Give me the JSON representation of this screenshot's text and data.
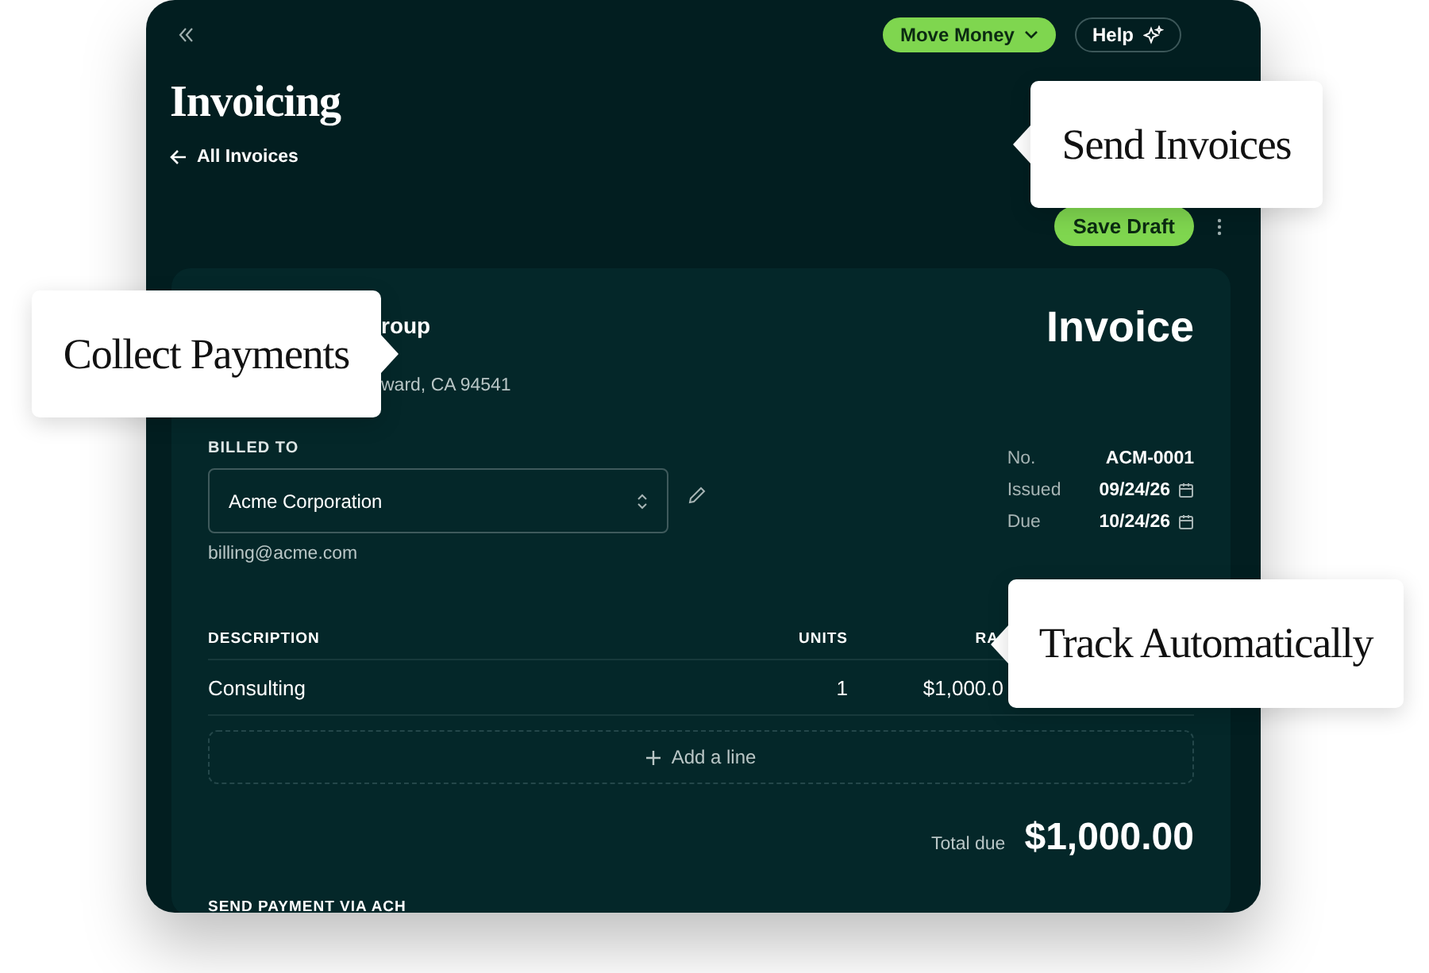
{
  "top_bar": {
    "buttons": [
      {
        "label": "Move Money",
        "kind": "primary"
      },
      {
        "label": "Help",
        "kind": "outline"
      }
    ]
  },
  "page": {
    "title": "Invoicing",
    "back_link": "All Invoices",
    "save_button": "Save Draft"
  },
  "invoice": {
    "company_name": "roup",
    "company_address": "ward, CA 94541",
    "heading": "Invoice",
    "billed_to": {
      "label": "BILLED TO",
      "value": "Acme Corporation",
      "email": "billing@acme.com"
    },
    "meta": [
      {
        "label": "No.",
        "value": "ACM-0001",
        "kind": "text"
      },
      {
        "label": "Issued",
        "value": "09/24/26",
        "kind": "date"
      },
      {
        "label": "Due",
        "value": "10/24/26",
        "kind": "date"
      }
    ],
    "table": {
      "columns": [
        "DESCRIPTION",
        "UNITS",
        "RA"
      ],
      "rows": [
        [
          "Consulting",
          "1",
          "$1,000.0"
        ]
      ]
    },
    "add_line": "Add a line",
    "total_label": "Total due",
    "total_value": "$1,000.00",
    "payment_heading": "SEND PAYMENT VIA ACH"
  },
  "callouts": [
    {
      "text": "Send Invoices",
      "kind": "left"
    },
    {
      "text": "Collect Payments",
      "kind": "right"
    },
    {
      "text": "Track Automatically",
      "kind": "left"
    }
  ]
}
